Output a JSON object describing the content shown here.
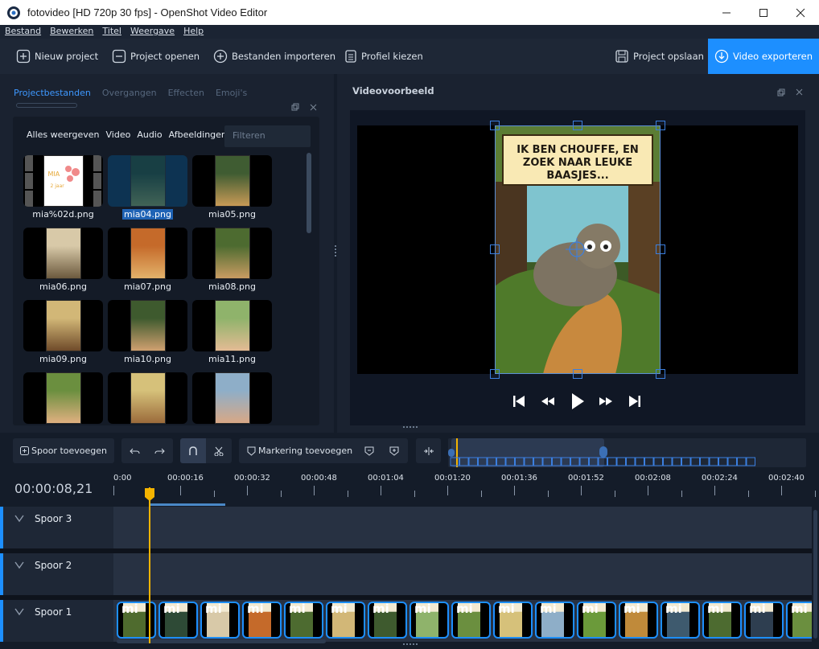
{
  "window": {
    "title": "fotovideo [HD 720p 30 fps] - OpenShot Video Editor"
  },
  "menu": [
    "Bestand",
    "Bewerken",
    "Titel",
    "Weergave",
    "Help"
  ],
  "toolbar": {
    "new_project": "Nieuw project",
    "open_project": "Project openen",
    "import_files": "Bestanden importeren",
    "choose_profile": "Profiel kiezen",
    "save_project": "Project opslaan",
    "export_video": "Video exporteren"
  },
  "left_tabs": [
    "Projectbestanden",
    "Overgangen",
    "Effecten",
    "Emoji's"
  ],
  "filters": {
    "all": "Alles weergeven",
    "video": "Video",
    "audio": "Audio",
    "images": "Afbeeldingen",
    "filter_placeholder": "Filteren"
  },
  "files": [
    "mia%02d.png",
    "mia04.png",
    "mia05.png",
    "mia06.png",
    "mia07.png",
    "mia08.png",
    "mia09.png",
    "mia10.png",
    "mia11.png",
    "",
    "",
    ""
  ],
  "selected_file": "mia04.png",
  "first_thumb_text": {
    "name": "MIA",
    "age": "2 jaar"
  },
  "preview": {
    "title": "Videovoorbeeld",
    "caption": "IK BEN CHOUFFE, EN ZOEK NAAR LEUKE BAASJES..."
  },
  "timeline_toolbar": {
    "add_track": "Spoor toevoegen",
    "add_marker": "Markering toevoegen"
  },
  "timecode": "00:00:08,21",
  "ruler_labels": [
    "0:00",
    "00:00:16",
    "00:00:32",
    "00:00:48",
    "00:01:04",
    "00:01:20",
    "00:01:36",
    "00:01:52",
    "00:02:08",
    "00:02:24",
    "00:02:40"
  ],
  "tracks": [
    "Spoor 3",
    "Spoor 2",
    "Spoor 1"
  ],
  "clip_label": "mi",
  "colors": {
    "accent": "#1d8fff",
    "playhead": "#f5b400",
    "background": "#141c29"
  }
}
